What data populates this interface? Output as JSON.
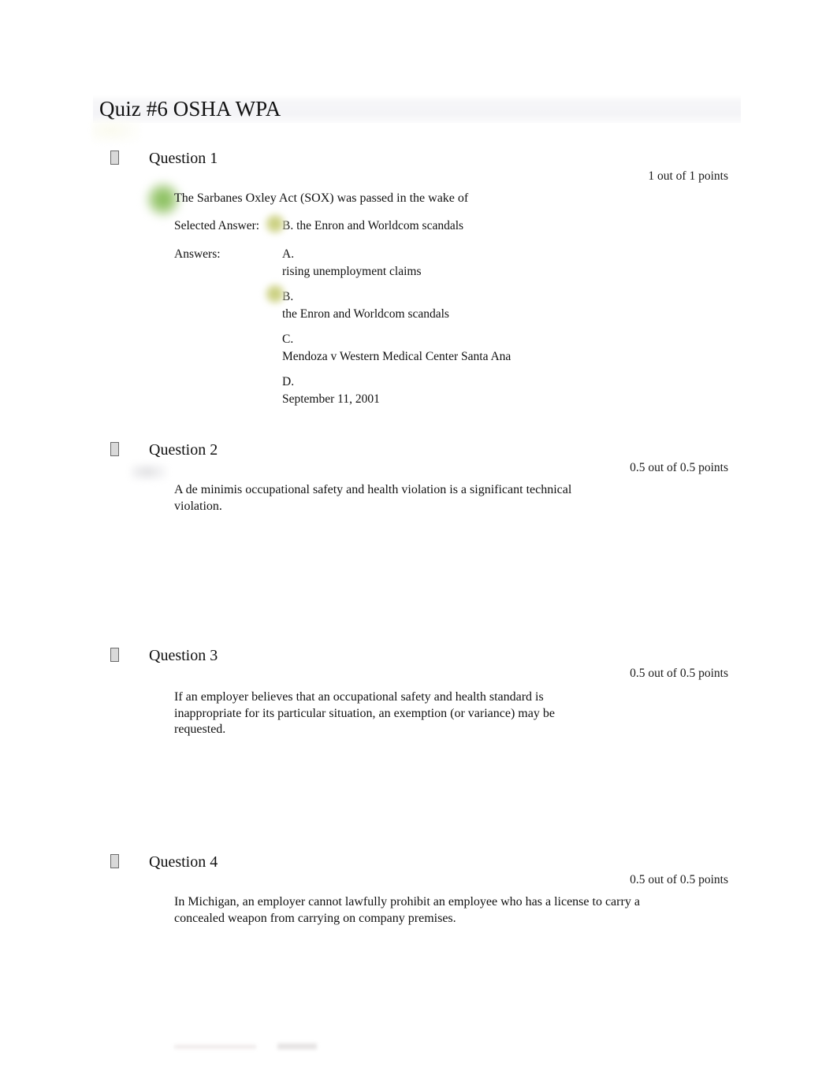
{
  "document": {
    "title": "Quiz #6 OSHA WPA"
  },
  "questions": [
    {
      "marker_icon": "missing-glyph-box",
      "label": "Question 1",
      "points": "1 out of 1 points",
      "stem": "The Sarbanes Oxley Act (SOX) was passed in the wake of",
      "selected_answer_label": "Selected Answer:",
      "selected_answer": {
        "letter": "B.",
        "text": "the Enron and Worldcom scandals",
        "marker": "correct-green-blob"
      },
      "answers_label": "Answers:",
      "options": [
        {
          "letter": "A.",
          "text": "rising unemployment claims",
          "marker": "none"
        },
        {
          "letter": "B.",
          "text": "the Enron and Worldcom scandals",
          "marker": "correct-green-blob"
        },
        {
          "letter": "C.",
          "text": "Mendoza v Western Medical Center Santa Ana",
          "marker": "none"
        },
        {
          "letter": "D.",
          "text": "September 11, 2001",
          "marker": "none"
        }
      ]
    },
    {
      "marker_icon": "missing-glyph-box",
      "label": "Question 2",
      "points": "0.5 out of 0.5 points",
      "stem": "A de minimis occupational safety and health violation is a significant technical violation.",
      "marker": "blurred-grey-blob"
    },
    {
      "marker_icon": "missing-glyph-box",
      "label": "Question 3",
      "points": "0.5 out of 0.5 points",
      "stem": "If an employer believes that an occupational safety and health standard is inappropriate for its particular situation, an exemption (or variance) may be requested."
    },
    {
      "marker_icon": "missing-glyph-box",
      "label": "Question 4",
      "points": "0.5 out of 0.5 points",
      "stem": "In Michigan, an employer cannot lawfully prohibit an employee who has a license to carry a concealed weapon from carrying on company premises."
    }
  ],
  "colors": {
    "correct_marker_green": "#7fba52",
    "correct_marker_yellow_green": "#c2c96f",
    "title_band": "#f4f4f7",
    "text": "#111111"
  }
}
